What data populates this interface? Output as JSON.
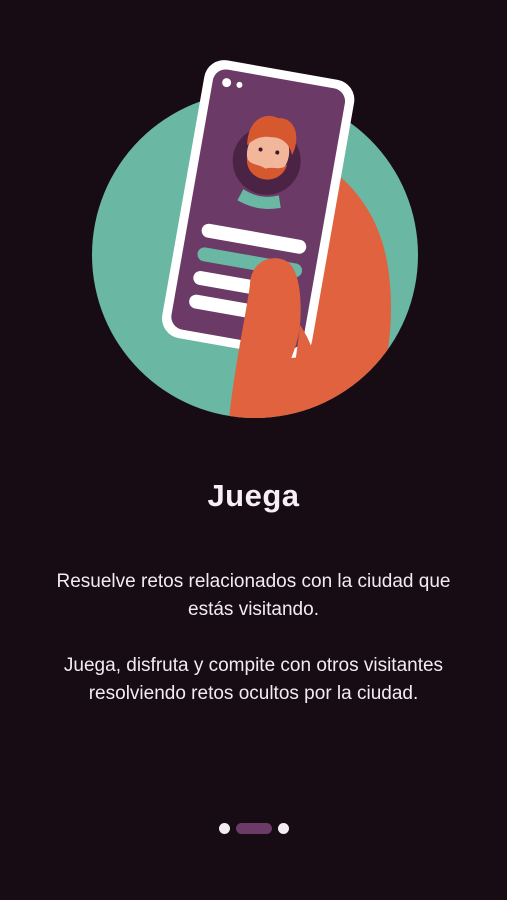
{
  "onboarding": {
    "title": "Juega",
    "paragraph_1": "Resuelve retos relacionados con la ciudad que estás visitando.",
    "paragraph_2": "Juega, disfruta y compite con otros visitantes resolviendo retos ocultos por la ciudad."
  },
  "pager": {
    "total": 3,
    "active_index": 1
  },
  "colors": {
    "background": "#170b14",
    "circle": "#6ab7a3",
    "phone_screen": "#6b3a66",
    "hand": "#e0623e",
    "active_indicator": "#6b3a66"
  },
  "illustration": {
    "icon": "phone-in-hand-illustration"
  }
}
